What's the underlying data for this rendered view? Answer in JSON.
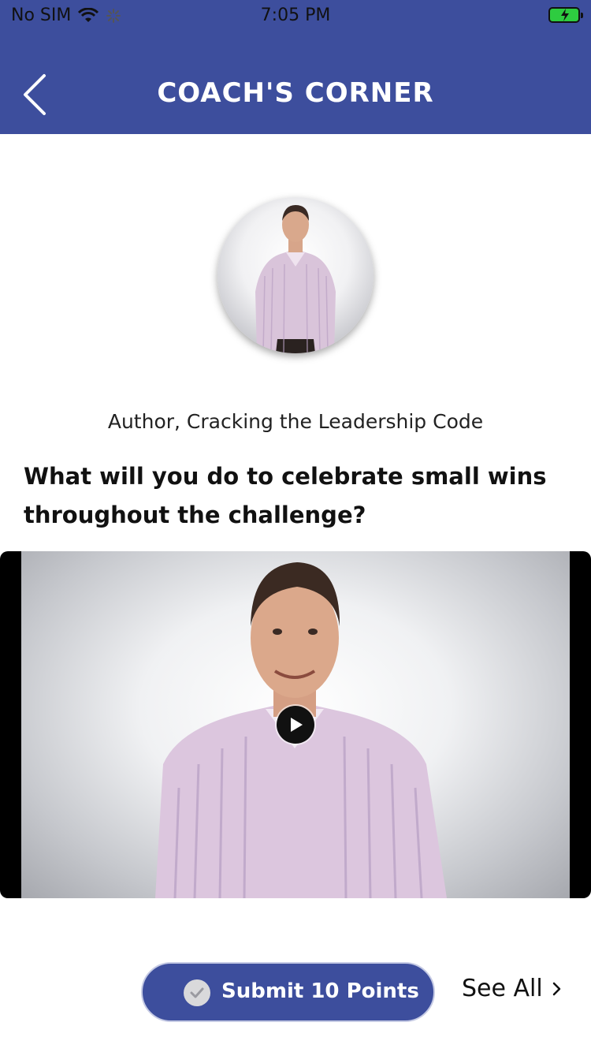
{
  "status_bar": {
    "carrier": "No SIM",
    "time": "7:05 PM"
  },
  "header": {
    "title": "COACH'S CORNER"
  },
  "coach": {
    "role": "Author, Cracking the Leadership Code"
  },
  "question": "What will you do to celebrate small wins throughout the challenge?",
  "actions": {
    "submit_label": "Submit 10 Points",
    "see_all_label": "See All"
  },
  "colors": {
    "brand": "#3d4e9d",
    "battery": "#2ecc40"
  }
}
